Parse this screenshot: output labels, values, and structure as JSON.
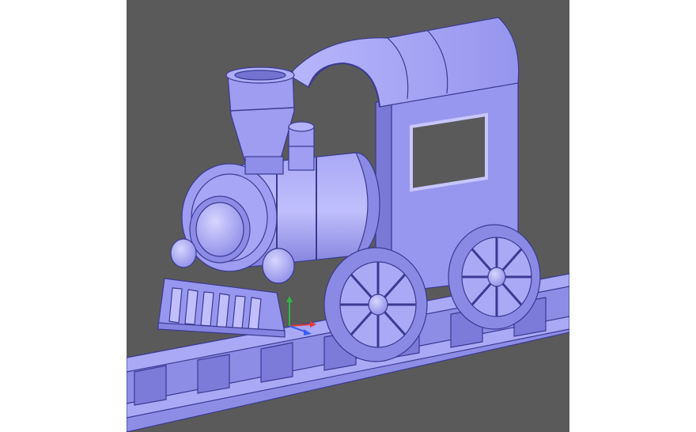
{
  "colors": {
    "page_background": "#ffffff",
    "viewport_background": "#5a5a5a",
    "model_base": "#9d9cf0",
    "model_light": "#c3c2fb",
    "model_shadow": "#6e6dcc",
    "edge_lines": "#3b3a92",
    "axis_x": "#e23b3b",
    "axis_y": "#2fb54a",
    "axis_z": "#3a5cf2"
  },
  "model": {
    "subject": "steam-locomotive-toy",
    "shading": "solid-with-edges",
    "parts": [
      "track",
      "cab",
      "roof",
      "cab-window",
      "boiler",
      "smokestack",
      "steam-dome",
      "headlight",
      "buffers",
      "cowcatcher",
      "rear-wheel",
      "front-wheel"
    ]
  },
  "axes_gizmo": {
    "icon": "xyz-triad-icon",
    "axes": [
      "x",
      "y",
      "z"
    ]
  }
}
